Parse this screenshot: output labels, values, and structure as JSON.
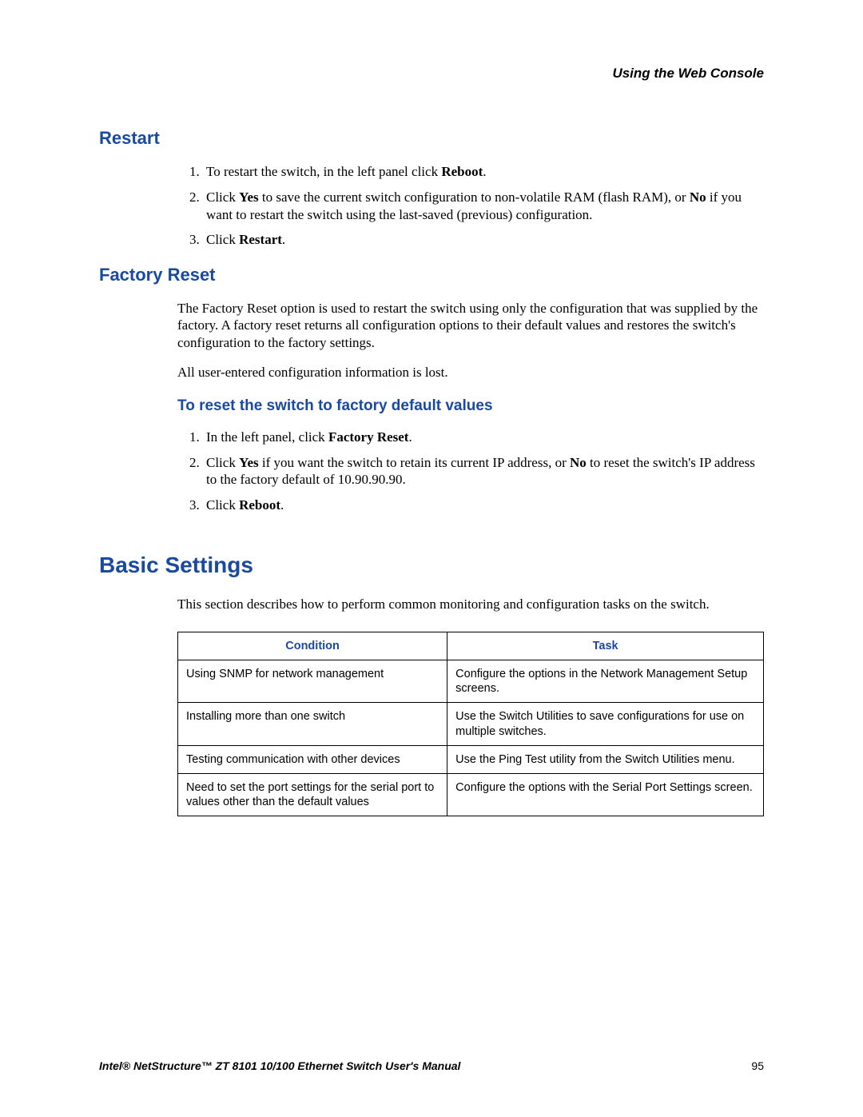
{
  "running_head": "Using the Web Console",
  "sections": {
    "restart": {
      "title": "Restart",
      "steps": [
        {
          "pre": "To restart the switch, in the left panel click ",
          "bold": "Reboot",
          "post": "."
        },
        {
          "pre": "Click ",
          "bold": "Yes",
          "mid": " to save the current switch configuration to non-volatile RAM (flash RAM), or ",
          "bold2": "No",
          "post": " if you want to restart the switch using the last-saved (previous) configuration."
        },
        {
          "pre": "Click ",
          "bold": "Restart",
          "post": "."
        }
      ]
    },
    "factory_reset": {
      "title": "Factory Reset",
      "para1": "The Factory Reset option is used to restart the switch using only the configuration that was supplied by the factory. A factory reset returns all configuration options to their default values and restores the switch's configuration to the factory settings.",
      "para2": "All user-entered configuration information is lost.",
      "sub_title": "To reset the switch to factory default values",
      "steps": [
        {
          "pre": "In the left panel, click ",
          "bold": "Factory Reset",
          "post": "."
        },
        {
          "pre": "Click ",
          "bold": "Yes",
          "mid": " if you want the switch to retain its current IP address, or ",
          "bold2": "No",
          "post": " to reset the switch's IP address to the factory default of 10.90.90.90."
        },
        {
          "pre": "Click ",
          "bold": "Reboot",
          "post": "."
        }
      ]
    },
    "basic_settings": {
      "title": "Basic Settings",
      "intro": "This section describes how to perform common monitoring and configuration tasks on the switch.",
      "table": {
        "headers": {
          "c1": "Condition",
          "c2": "Task"
        },
        "rows": [
          {
            "c1": "Using SNMP for network management",
            "c2": "Configure the options in the Network Management Setup screens."
          },
          {
            "c1": "Installing more than one switch",
            "c2": "Use the Switch Utilities to save configurations for use on multiple switches."
          },
          {
            "c1": "Testing communication with other devices",
            "c2": "Use the Ping Test utility from the Switch Utilities menu."
          },
          {
            "c1": "Need to set the port settings for the serial port to values other than the default values",
            "c2": "Configure the options with the Serial Port Settings screen."
          }
        ]
      }
    }
  },
  "footer": {
    "title": "Intel® NetStructure™  ZT 8101 10/100 Ethernet Switch User's Manual",
    "page": "95"
  }
}
